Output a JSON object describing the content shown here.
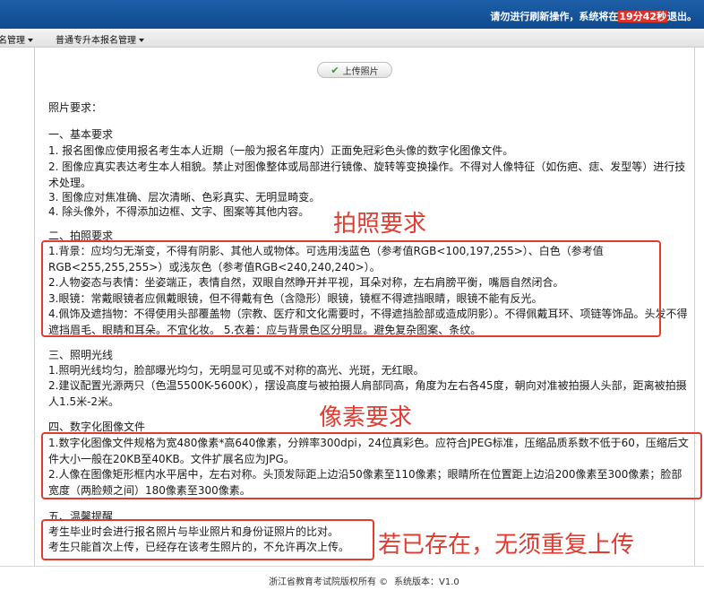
{
  "header": {
    "notice_prefix": "请勿进行刷新操作，系统将在",
    "timer": "19分42秒",
    "notice_suffix": "退出。"
  },
  "menu": {
    "items": [
      {
        "label": "名管理"
      },
      {
        "label": "普通专升本报名管理"
      }
    ]
  },
  "upload_button": {
    "label": "上传照片",
    "icon": "check-icon"
  },
  "content": {
    "heading": "照片要求：",
    "s1_title": "一、基本要求",
    "s1_l1": "1. 报名图像应使用报名考生本人近期（一般为报名年度内）正面免冠彩色头像的数字化图像文件。",
    "s1_l2": "2. 图像应真实表达考生本人相貌。禁止对图像整体或局部进行镜像、旋转等变换操作。不得对人像特征（如伤疤、痣、发型等）进行技术处理。",
    "s1_l3": "3. 图像应对焦准确、层次清晰、色彩真实、无明显畸变。",
    "s1_l4": "4. 除头像外，不得添加边框、文字、图案等其他内容。",
    "s2_title": "二、拍照要求",
    "s2_l1": "1.背景：应均匀无渐变，不得有阴影、其他人或物体。可选用浅蓝色（参考值RGB<100,197,255>）、白色（参考值RGB<255,255,255>）或浅灰色（参考值RGB<240,240,240>）。",
    "s2_l2": "2.人物姿态与表情：坐姿端正，表情自然，双眼自然睁开并平视，耳朵对称，左右肩膀平衡，嘴唇自然闭合。",
    "s2_l3": "3.眼镜：常戴眼镜者应佩戴眼镜，但不得戴有色（含隐形）眼镜，镜框不得遮挡眼睛，眼镜不能有反光。",
    "s2_l4": "4.佩饰及遮挡物：不得使用头部覆盖物（宗教、医疗和文化需要时，不得遮挡脸部或造成阴影）。不得佩戴耳环、项链等饰品。头发不得遮挡眉毛、眼睛和耳朵。不宜化妆。 5.衣着：应与背景色区分明显。避免复杂图案、条纹。",
    "s3_title": "三、照明光线",
    "s3_l1": "1.照明光线均匀，脸部曝光均匀，无明显可见或不对称的高光、光斑，无红眼。",
    "s3_l2": "2.建议配置光源两只（色温5500K-5600K），摆设高度与被拍摄人肩部同高，角度为左右各45度，朝向对准被拍摄人头部，距离被拍摄人1.5米-2米。",
    "s4_title": "四、数字化图像文件",
    "s4_l1": "1.数字化图像文件规格为宽480像素*高640像素，分辨率300dpi，24位真彩色。应符合JPEG标准，压缩品质系数不低于60，压缩后文件大小一般在20KB至40KB。文件扩展名应为JPG。",
    "s4_l2": "2.人像在图像矩形框内水平居中，左右对称。头顶发际距上边沿50像素至110像素；眼睛所在位置距上边沿200像素至300像素；脸部宽度（两脸颊之间）180像素至300像素。",
    "s5_title": "五、温馨提醒",
    "s5_l1": "考生毕业时会进行报名照片与毕业照片和身份证照片的比对。",
    "s5_l2": "考生只能首次上传，已经存在该考生照片的，不允许再次上传。"
  },
  "annotations": {
    "a1": "拍照要求",
    "a2": "像素要求",
    "a3": "若已存在，无须重复上传",
    "color": "#e23b30"
  },
  "footer": {
    "copyright": "浙江省教育考试院版权所有 ©",
    "version": "系统版本：V1.0"
  }
}
